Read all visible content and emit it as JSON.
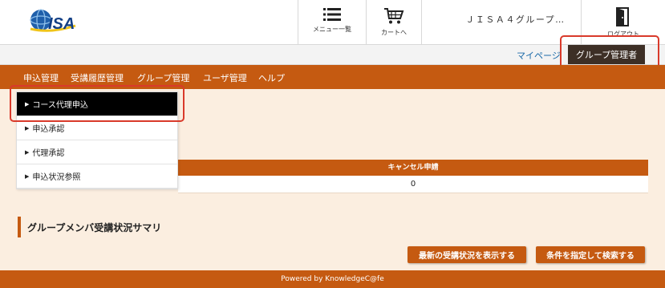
{
  "header": {
    "logo_text": "JISA",
    "menu_label": "メニュー一覧",
    "cart_label": "カートへ",
    "group_name": "ＪＩＳＡ４グループ…",
    "logout_label": "ログアウト"
  },
  "subheader": {
    "mypage_label": "マイページ",
    "role_label": "グループ管理者"
  },
  "nav": {
    "items": [
      "申込管理",
      "受講履歴管理",
      "グループ管理",
      "ユーザ管理",
      "ヘルプ"
    ]
  },
  "dropdown": {
    "items": [
      "コース代理申込",
      "申込承認",
      "代理承認",
      "申込状況参照"
    ]
  },
  "table": {
    "header": "キャンセル申請",
    "value": "0"
  },
  "section": {
    "title": "グループメンバ受講状況サマリ"
  },
  "buttons": {
    "latest": "最新の受講状況を表示する",
    "search": "条件を指定して検索する"
  },
  "footer": {
    "text": "Powered by KnowledgeC@fe"
  },
  "colors": {
    "accent": "#c55a11",
    "content_bg": "#fbeee0",
    "dark_button": "#3d2f26",
    "highlight": "#d93a2b",
    "link": "#1b6aa8"
  }
}
